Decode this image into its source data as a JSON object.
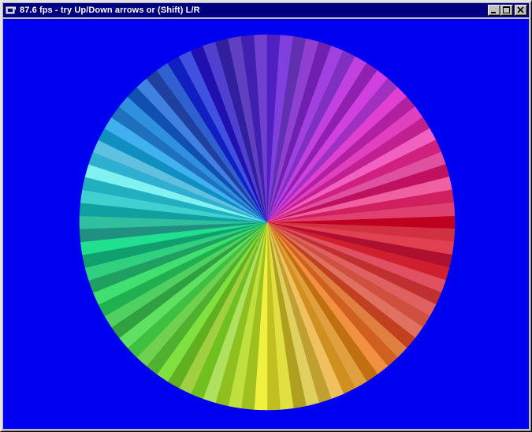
{
  "window": {
    "title": "87.6 fps - try Up/Down arrows or (Shift) L/R",
    "buttons": [
      "minimize",
      "maximize",
      "close"
    ],
    "background_color": "#0000f0",
    "titlebar_color": "#000080"
  },
  "icons": {
    "app": "app-icon",
    "minimize": "minimize-icon",
    "maximize": "maximize-icon",
    "close": "close-icon"
  },
  "color_wheel": {
    "segments": 90,
    "colors": [
      "#c00020",
      "#d03040",
      "#e04050",
      "#b01030",
      "#d02030",
      "#e05060",
      "#c03030",
      "#e06060",
      "#d05040",
      "#e07060",
      "#c04020",
      "#e08040",
      "#d06020",
      "#f09040",
      "#c07010",
      "#e0a040",
      "#d09020",
      "#f0c060",
      "#c0a030",
      "#e0d060",
      "#b0a020",
      "#e0e040",
      "#c0c020",
      "#f0f040",
      "#a0c020",
      "#c0e040",
      "#90c020",
      "#b0e060",
      "#70c020",
      "#a0d040",
      "#60b020",
      "#80e040",
      "#50b030",
      "#70d050",
      "#40c040",
      "#60e060",
      "#30a040",
      "#50d060",
      "#20b050",
      "#40e070",
      "#20a060",
      "#30d080",
      "#10a070",
      "#20e090",
      "#209080",
      "#30c0a0",
      "#10a0a0",
      "#40d0d0",
      "#20b0c0",
      "#80f0f0",
      "#30b0d0",
      "#60c0e0",
      "#1090c0",
      "#40b0f0",
      "#2070c0",
      "#3090e0",
      "#1050b0",
      "#4080e0",
      "#2040a0",
      "#3060d0",
      "#1020c0",
      "#4050e0",
      "#2010b0",
      "#5040d0",
      "#3020a0",
      "#6040c0",
      "#4020b0",
      "#7040d0",
      "#5020c0",
      "#8040e0",
      "#6030b0",
      "#9040d0",
      "#7020b0",
      "#a040e0",
      "#8030c0",
      "#c040e0",
      "#9020b0",
      "#d040e0",
      "#a030c0",
      "#e040d0",
      "#b020a0",
      "#e040c0",
      "#c02090",
      "#f060c0",
      "#d02080",
      "#e050a0",
      "#c01060",
      "#f060a0",
      "#d02060",
      "#e04070"
    ]
  }
}
